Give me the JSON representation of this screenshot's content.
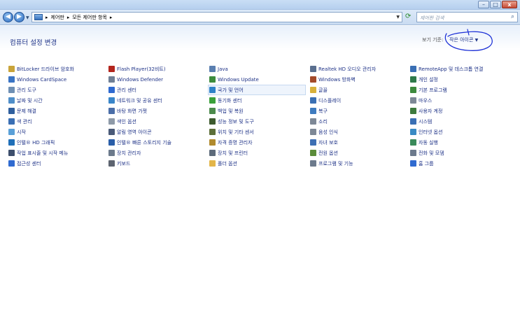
{
  "titlebar": {
    "minimize_label": "–",
    "maximize_label": "□",
    "close_label": "x"
  },
  "nav": {
    "back_label": "◀",
    "forward_label": "▶",
    "breadcrumb": [
      "제어판",
      "모든 제어판 항목"
    ],
    "separator": "▸",
    "search_placeholder": "제어판 검색"
  },
  "header": {
    "title": "컴퓨터 설정 변경",
    "view_by_label": "보기 기준:",
    "view_by_value": "작은 아이콘",
    "view_by_arrow": "▼"
  },
  "columns": [
    [
      {
        "label": "BitLocker 드라이브 암호화",
        "icon": "bitlocker-icon",
        "color": "#c9a43a"
      },
      {
        "label": "Windows CardSpace",
        "icon": "cardspace-icon",
        "color": "#3a74c4"
      },
      {
        "label": "관리 도구",
        "icon": "admin-tools-icon",
        "color": "#6e8fb4"
      },
      {
        "label": "날짜 및 시간",
        "icon": "clock-icon",
        "color": "#4f8ec9"
      },
      {
        "label": "문제 해결",
        "icon": "troubleshoot-icon",
        "color": "#2f5f9e"
      },
      {
        "label": "색 관리",
        "icon": "color-management-icon",
        "color": "#3a6fb4"
      },
      {
        "label": "시작",
        "icon": "getting-started-icon",
        "color": "#5aa0d8"
      },
      {
        "label": "인텔® HD 그래픽",
        "icon": "intel-graphics-icon",
        "color": "#1f6fb8"
      },
      {
        "label": "작업 표시줄 및 시작 메뉴",
        "icon": "taskbar-icon",
        "color": "#3d4e6c"
      },
      {
        "label": "접근성 센터",
        "icon": "ease-of-access-icon",
        "color": "#2f6ad0"
      }
    ],
    [
      {
        "label": "Flash Player(32비트)",
        "icon": "flash-icon",
        "color": "#b3261e"
      },
      {
        "label": "Windows Defender",
        "icon": "defender-icon",
        "color": "#6f7f95"
      },
      {
        "label": "관리 센터",
        "icon": "action-center-icon",
        "color": "#2f6ad0"
      },
      {
        "label": "네트워크 및 공유 센터",
        "icon": "network-icon",
        "color": "#3a86c9"
      },
      {
        "label": "바탕 화면 가젯",
        "icon": "gadgets-icon",
        "color": "#4b6ea8"
      },
      {
        "label": "색인 옵션",
        "icon": "indexing-icon",
        "color": "#8e9aa8"
      },
      {
        "label": "알림 영역 아이콘",
        "icon": "notification-icon",
        "color": "#4a5a78"
      },
      {
        "label": "인텔® 빠른 스토리지 기술",
        "icon": "intel-storage-icon",
        "color": "#2a5ea8"
      },
      {
        "label": "장치 관리자",
        "icon": "device-manager-icon",
        "color": "#6c7a8c"
      },
      {
        "label": "키보드",
        "icon": "keyboard-icon",
        "color": "#5d6470"
      }
    ],
    [
      {
        "label": "Java",
        "icon": "java-icon",
        "color": "#5a7fb0"
      },
      {
        "label": "Windows Update",
        "icon": "windows-update-icon",
        "color": "#3d8c3d"
      },
      {
        "label": "국가 및 언어",
        "icon": "region-icon",
        "color": "#2f82c8",
        "selected": true
      },
      {
        "label": "동기화 센터",
        "icon": "sync-icon",
        "color": "#3aa03a"
      },
      {
        "label": "백업 및 복원",
        "icon": "backup-icon",
        "color": "#4c8a4c"
      },
      {
        "label": "성능 정보 및 도구",
        "icon": "performance-icon",
        "color": "#3d5a2e"
      },
      {
        "label": "위치 및 기타 센서",
        "icon": "sensor-icon",
        "color": "#5d6f3a"
      },
      {
        "label": "자격 증명 관리자",
        "icon": "credential-icon",
        "color": "#b08a2e"
      },
      {
        "label": "장치 및 프린터",
        "icon": "printer-icon",
        "color": "#5d6a7a"
      },
      {
        "label": "폴더 옵션",
        "icon": "folder-icon",
        "color": "#e3b64a"
      }
    ],
    [
      {
        "label": "Realtek HD 오디오 관리자",
        "icon": "audio-manager-icon",
        "color": "#5a6f8f"
      },
      {
        "label": "Windows 방화벽",
        "icon": "firewall-icon",
        "color": "#a34a2a"
      },
      {
        "label": "글꼴",
        "icon": "fonts-icon",
        "color": "#d8b13a"
      },
      {
        "label": "디스플레이",
        "icon": "display-icon",
        "color": "#3a6fb4"
      },
      {
        "label": "복구",
        "icon": "recovery-icon",
        "color": "#3e7bbf"
      },
      {
        "label": "소리",
        "icon": "sound-icon",
        "color": "#7d8896"
      },
      {
        "label": "음성 인식",
        "icon": "speech-icon",
        "color": "#7d8896"
      },
      {
        "label": "자녀 보호",
        "icon": "parental-controls-icon",
        "color": "#3d6fb4"
      },
      {
        "label": "전원 옵션",
        "icon": "power-icon",
        "color": "#5b8c3a"
      },
      {
        "label": "프로그램 및 기능",
        "icon": "programs-icon",
        "color": "#6c7a8c"
      }
    ],
    [
      {
        "label": "RemoteApp 및 데스크톱 연결",
        "icon": "remoteapp-icon",
        "color": "#3a6fb4"
      },
      {
        "label": "개인 설정",
        "icon": "personalization-icon",
        "color": "#2f7a4a"
      },
      {
        "label": "기본 프로그램",
        "icon": "default-programs-icon",
        "color": "#3d8a3d"
      },
      {
        "label": "마우스",
        "icon": "mouse-icon",
        "color": "#7d8896"
      },
      {
        "label": "사용자 계정",
        "icon": "user-accounts-icon",
        "color": "#3d7a3d"
      },
      {
        "label": "시스템",
        "icon": "system-icon",
        "color": "#3a6fb4"
      },
      {
        "label": "인터넷 옵션",
        "icon": "internet-options-icon",
        "color": "#3a8ac4"
      },
      {
        "label": "자동 실행",
        "icon": "autoplay-icon",
        "color": "#3a8a5a"
      },
      {
        "label": "전화 및 모뎀",
        "icon": "phone-modem-icon",
        "color": "#6c7a8c"
      },
      {
        "label": "홈 그룹",
        "icon": "homegroup-icon",
        "color": "#2f6ad0"
      }
    ]
  ]
}
